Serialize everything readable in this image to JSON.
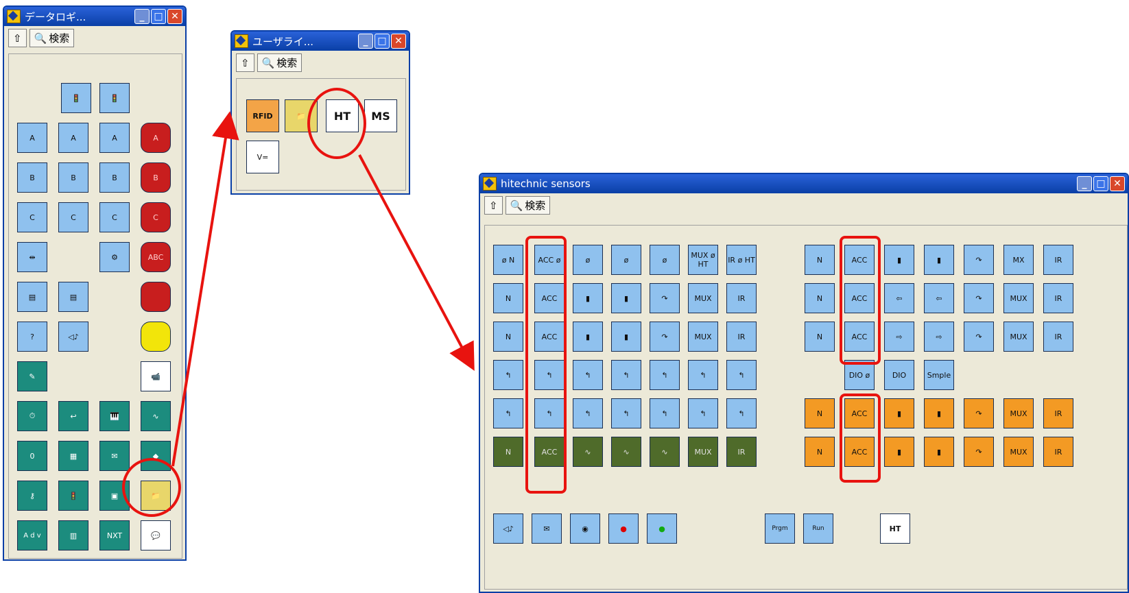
{
  "windows": {
    "datalog": {
      "title": "データロギ...",
      "up_label": "⇧",
      "search_label": "検索"
    },
    "user": {
      "title": "ユーザライ...",
      "up_label": "⇧",
      "search_label": "検索"
    },
    "hitechnic": {
      "title": "hitechnic sensors",
      "up_label": "⇧",
      "search_label": "検索"
    }
  },
  "user_palette": {
    "rfid": "RFID",
    "ht": "HT",
    "ms": "MS",
    "v": "V="
  },
  "left_palette": {
    "labels": {
      "a": "A",
      "b": "B",
      "c": "C",
      "abc": "ABC",
      "zero": "0",
      "nxt": "NXT",
      "adv": "A d v"
    }
  },
  "hitechnic_palette": {
    "row1": [
      "ø N",
      "ACC ø",
      "ø",
      "ø",
      "ø",
      "MUX ø HT",
      "IR ø HT"
    ],
    "row2": [
      "N",
      "ACC",
      "",
      "",
      "",
      "MUX",
      "IR"
    ],
    "row3": [
      "N",
      "ACC",
      "",
      "",
      "",
      "MUX",
      "IR"
    ],
    "right_row1": [
      "N",
      "ACC",
      "",
      "",
      "",
      "MX",
      "IR"
    ],
    "right_row2": [
      "N",
      "ACC",
      "",
      "",
      "",
      "MUX",
      "IR"
    ],
    "right_row3": [
      "N",
      "ACC",
      "",
      "",
      "",
      "MUX",
      "IR"
    ],
    "dio_row": [
      "DIO ø",
      "DIO",
      "Smple"
    ],
    "orange_row1": [
      "N",
      "ACC",
      "",
      "",
      "",
      "MUX",
      "IR"
    ],
    "orange_row2": [
      "N",
      "ACC",
      "",
      "",
      "",
      "MUX",
      "IR"
    ],
    "wave_row": [
      "N",
      "ACC",
      "",
      "",
      "",
      "MUX",
      "IR"
    ],
    "bottom_prgm": "Prgm",
    "bottom_run": "Run",
    "bottom_ht": "HT"
  },
  "colors": {
    "highlight": "#e8130f",
    "titlebar": "#0a3fa6",
    "tile_blue": "#8fc1ee",
    "tile_orange": "#f39a24",
    "tile_teal": "#1c8c7e"
  }
}
